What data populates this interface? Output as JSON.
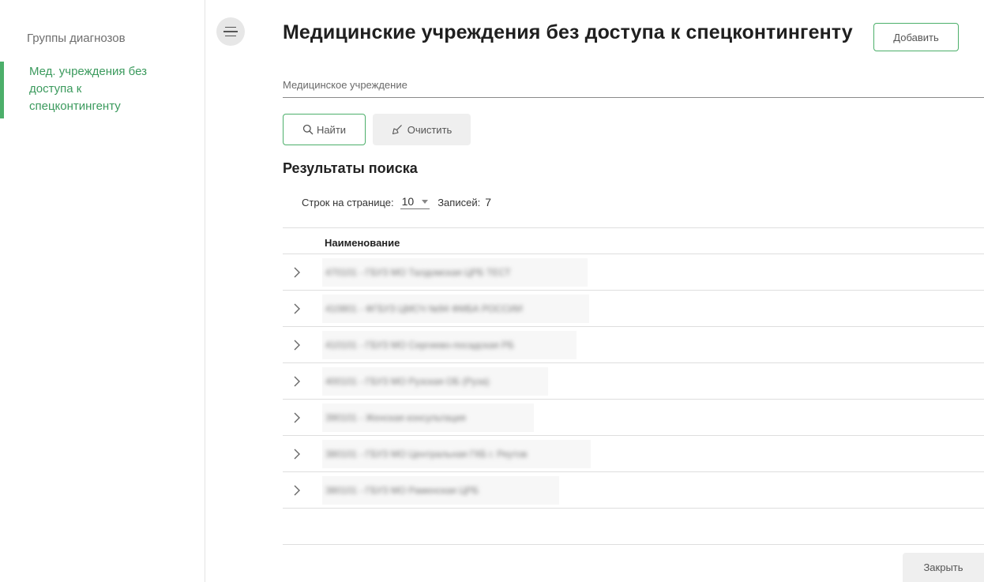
{
  "sidebar": {
    "items": [
      {
        "label": "Группы диагнозов"
      },
      {
        "label_lines": [
          "Мед. учреждения без",
          "доступа к",
          "спецконтингенту"
        ]
      }
    ]
  },
  "header": {
    "title": "Медицинские учреждения без доступа к спецконтингенту",
    "add_label": "Добавить"
  },
  "search": {
    "field_label": "Медицинское учреждение",
    "field_value": "",
    "find_label": "Найти",
    "clear_label": "Очистить"
  },
  "results": {
    "title": "Результаты поиска",
    "rows_per_page_label": "Строк на странице:",
    "rows_per_page_value": "10",
    "records_label": "Записей:",
    "records_value": "7",
    "column_header": "Наименование",
    "rows": [
      "470101 - ГБУЗ МО Талдомская ЦРБ ТЕСТ",
      "410801 - ФГБУЗ ЦМСЧ №94 ФМБА РОССИИ",
      "410101 - ГБУЗ МО Сергиево-посадская РБ",
      "400101 - ГБУЗ МО Рузская ОБ (Руза)",
      "390101 - Женская консультация",
      "380101 - ГБУЗ МО Центральная ГКБ г. Реутов",
      "380101 - ГБУЗ МО Раменская ЦРБ"
    ]
  },
  "footer": {
    "close_label": "Закрыть"
  },
  "colors": {
    "accent": "#4caf6a",
    "accent_text": "#3b9a5d"
  },
  "icons": {
    "menu": "menu-icon",
    "search": "search-icon",
    "clear": "broom-icon",
    "row": "chevron-right-icon"
  }
}
